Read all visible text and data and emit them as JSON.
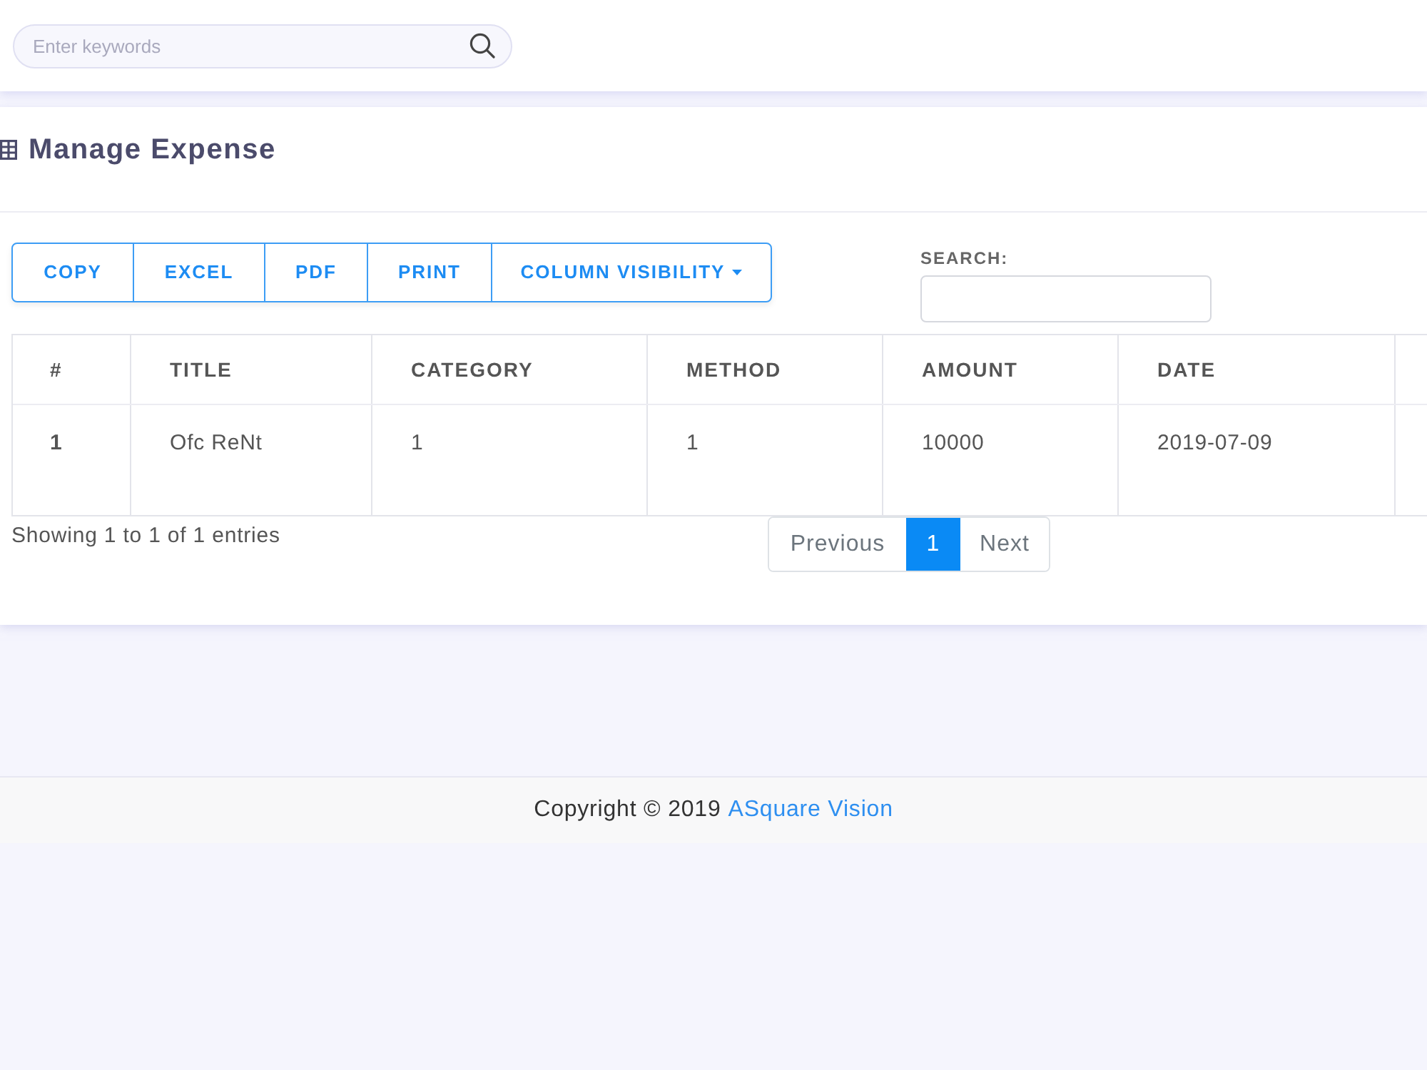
{
  "header": {
    "search": {
      "placeholder": "Enter keywords"
    }
  },
  "card": {
    "title": "Manage Expense",
    "export_buttons": [
      {
        "label": "COPY",
        "kind": "button"
      },
      {
        "label": "EXCEL",
        "kind": "button"
      },
      {
        "label": "PDF",
        "kind": "button"
      },
      {
        "label": "PRINT",
        "kind": "button"
      },
      {
        "label": "COLUMN VISIBILITY",
        "kind": "dropdown"
      }
    ],
    "search": {
      "label": "SEARCH:"
    },
    "table": {
      "columns": [
        "#",
        "TITLE",
        "CATEGORY",
        "METHOD",
        "AMOUNT",
        "DATE"
      ],
      "rows": [
        [
          "1",
          "Ofc ReNt",
          "1",
          "1",
          "10000",
          "2019-07-09"
        ]
      ]
    },
    "info": "Showing 1 to 1 of 1 entries",
    "pagination": [
      {
        "label": "Previous",
        "selected": false,
        "disabled": true
      },
      {
        "label": "1",
        "selected": true,
        "disabled": false
      },
      {
        "label": "Next",
        "selected": false,
        "disabled": true
      }
    ]
  },
  "footer": {
    "text": "Copyright © 2019",
    "link": "ASquare Vision"
  }
}
